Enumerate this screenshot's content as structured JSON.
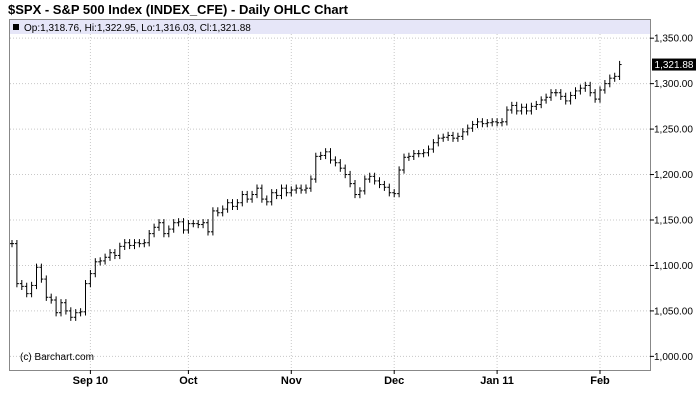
{
  "page": {
    "title": "$SPX - S&P 500 Index (INDEX_CFE) - Daily OHLC Chart"
  },
  "info_bar": {
    "text": "Op:1,318.76, Hi:1,322.95, Lo:1,316.03, Cl:1,321.88",
    "color": "#e6e6f8"
  },
  "credit": "(c) Barchart.com",
  "last_price_label": "1,321.88",
  "colors": {
    "bar": "#000000",
    "grid": "#c8c8c8",
    "price_box": "#000000",
    "price_text": "#ffffff"
  },
  "chart_data": {
    "type": "ohlc",
    "title": "$SPX - S&P 500 Index (INDEX_CFE) - Daily OHLC Chart",
    "ylim": [
      985,
      1370
    ],
    "y_ticks": [
      {
        "value": 1000,
        "label": "1,000.00"
      },
      {
        "value": 1050,
        "label": "1,050.00"
      },
      {
        "value": 1100,
        "label": "1,100.00"
      },
      {
        "value": 1150,
        "label": "1,150.00"
      },
      {
        "value": 1200,
        "label": "1,200.00"
      },
      {
        "value": 1250,
        "label": "1,250.00"
      },
      {
        "value": 1300,
        "label": "1,300.00"
      },
      {
        "value": 1350,
        "label": "1,350.00"
      }
    ],
    "x_ticks": [
      {
        "index": 16,
        "label": "Sep 10"
      },
      {
        "index": 36,
        "label": "Oct"
      },
      {
        "index": 57,
        "label": "Nov"
      },
      {
        "index": 78,
        "label": "Dec"
      },
      {
        "index": 99,
        "label": "Jan 11"
      },
      {
        "index": 120,
        "label": "Feb"
      }
    ],
    "grid": true,
    "close": [
      1124,
      1080,
      1077,
      1069,
      1078,
      1098,
      1085,
      1065,
      1062,
      1048,
      1059,
      1050,
      1043,
      1048,
      1049,
      1080,
      1091,
      1104,
      1105,
      1109,
      1114,
      1111,
      1121,
      1125,
      1122,
      1125,
      1124,
      1125,
      1135,
      1142,
      1147,
      1135,
      1140,
      1147,
      1148,
      1139,
      1146,
      1146,
      1145,
      1147,
      1137,
      1160,
      1158,
      1162,
      1169,
      1165,
      1169,
      1178,
      1173,
      1178,
      1185,
      1173,
      1170,
      1180,
      1177,
      1185,
      1180,
      1183,
      1185,
      1183,
      1185,
      1195,
      1220,
      1221,
      1225,
      1216,
      1213,
      1207,
      1200,
      1190,
      1178,
      1182,
      1195,
      1198,
      1193,
      1189,
      1186,
      1180,
      1179,
      1205,
      1219,
      1220,
      1223,
      1223,
      1224,
      1228,
      1235,
      1240,
      1241,
      1243,
      1240,
      1242,
      1247,
      1251,
      1255,
      1258,
      1256,
      1257,
      1258,
      1257,
      1258,
      1271,
      1276,
      1270,
      1274,
      1270,
      1275,
      1277,
      1282,
      1285,
      1290,
      1290,
      1286,
      1281,
      1287,
      1292,
      1295,
      1298,
      1290,
      1283,
      1293,
      1300,
      1306,
      1308,
      1321
    ]
  }
}
